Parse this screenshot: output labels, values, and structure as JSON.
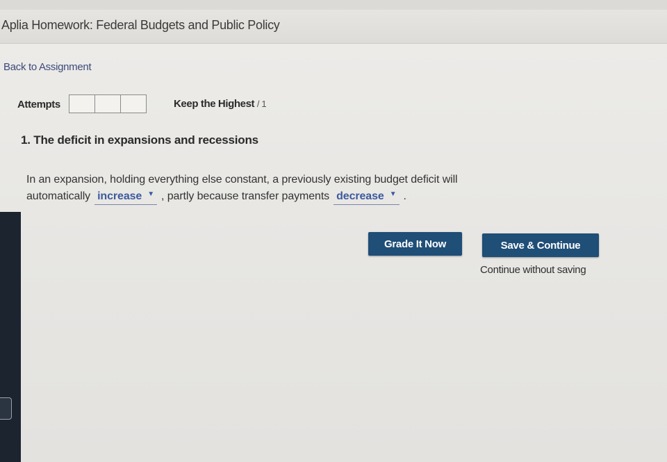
{
  "header": {
    "title": "Aplia Homework: Federal Budgets and Public Policy"
  },
  "nav": {
    "back_link": "Back to Assignment"
  },
  "attempts": {
    "label": "Attempts",
    "policy": "Keep the Highest",
    "score": "/ 1"
  },
  "question": {
    "title": "1. The deficit in expansions and recessions",
    "line1": "In an expansion, holding everything else constant, a previously existing budget deficit will",
    "line2_pre": "automatically",
    "dropdown1_value": "increase",
    "line2_mid": ", partly because transfer payments",
    "dropdown2_value": "decrease",
    "line2_end": "."
  },
  "actions": {
    "grade_label": "Grade It Now",
    "save_label": "Save & Continue",
    "continue_label": "Continue without saving"
  },
  "colors": {
    "button": "#1f4e77",
    "dropdown_text": "#3d5a9e",
    "rail": "#1c2430"
  }
}
